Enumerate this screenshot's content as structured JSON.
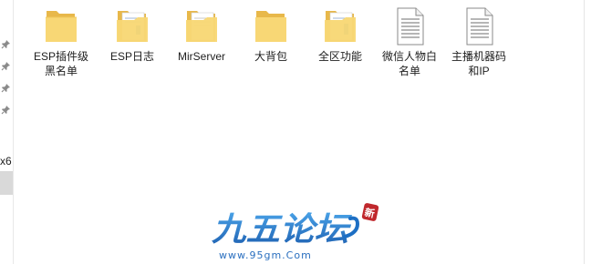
{
  "nav_pane": {
    "truncated_label": "x6",
    "pins": [
      "pin-icon",
      "pin-icon",
      "pin-icon",
      "pin-icon"
    ]
  },
  "files": [
    {
      "name": "ESP插件级黑名单",
      "lines": [
        "ESP插件级",
        "黑名单"
      ],
      "type": "folder",
      "icon": "folder-icon"
    },
    {
      "name": "ESP日志",
      "lines": [
        "ESP日志"
      ],
      "type": "folder-with-files",
      "icon": "folder-with-files-icon"
    },
    {
      "name": "MirServer",
      "lines": [
        "MirServer"
      ],
      "type": "folder-with-files",
      "icon": "folder-with-files-icon"
    },
    {
      "name": "大背包",
      "lines": [
        "大背包"
      ],
      "type": "folder",
      "icon": "folder-icon"
    },
    {
      "name": "全区功能",
      "lines": [
        "全区功能"
      ],
      "type": "folder-with-files",
      "icon": "folder-with-files-icon"
    },
    {
      "name": "微信人物白名单",
      "lines": [
        "微信人物白",
        "名单"
      ],
      "type": "text-file",
      "icon": "text-file-icon"
    },
    {
      "name": "主播机器码和IP",
      "lines": [
        "主播机器码",
        "和IP"
      ],
      "type": "text-file",
      "icon": "text-file-icon"
    }
  ],
  "watermark": {
    "logo_text": "九五论坛",
    "url": "www.95gm.Com",
    "seal": "新"
  },
  "colors": {
    "folder_back": "#e8b84a",
    "folder_front": "#f8d775",
    "logo_blue": "#1d6fc4",
    "seal_red": "#c0282d"
  }
}
